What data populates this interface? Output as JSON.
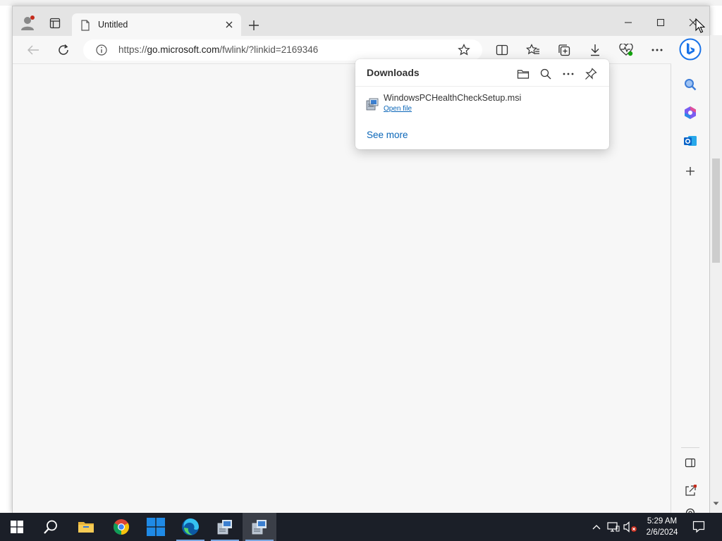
{
  "browser": {
    "tab": {
      "title": "Untitled"
    },
    "address": {
      "prefix": "https://",
      "host": "go.microsoft.com",
      "path": "/fwlink/?linkid=2169346"
    }
  },
  "downloads": {
    "title": "Downloads",
    "items": [
      {
        "filename": "WindowsPCHealthCheckSetup.msi",
        "action": "Open file"
      }
    ],
    "see_more": "See more"
  },
  "taskbar": {
    "clock_time": "5:29 AM",
    "clock_date": "2/6/2024"
  },
  "colors": {
    "accent": "#0a66b8",
    "taskbar": "#1b1f28",
    "notification_dot": "#c42b1c"
  },
  "icons": [
    "profile-icon",
    "tab-actions-icon",
    "page-icon",
    "close-icon",
    "plus-icon",
    "minimize-icon",
    "maximize-icon",
    "back-icon",
    "refresh-icon",
    "info-icon",
    "star-icon",
    "split-screen-icon",
    "favorites-icon",
    "collections-icon",
    "download-icon",
    "browser-essentials-icon",
    "more-icon",
    "bing-copilot-icon",
    "search-icon",
    "m365-icon",
    "outlook-icon",
    "folder-icon",
    "pin-icon",
    "sidebar-toggle-icon",
    "external-link-icon",
    "settings-icon",
    "windows-start-icon",
    "file-explorer-icon",
    "chrome-icon",
    "edge-icon"
  ]
}
